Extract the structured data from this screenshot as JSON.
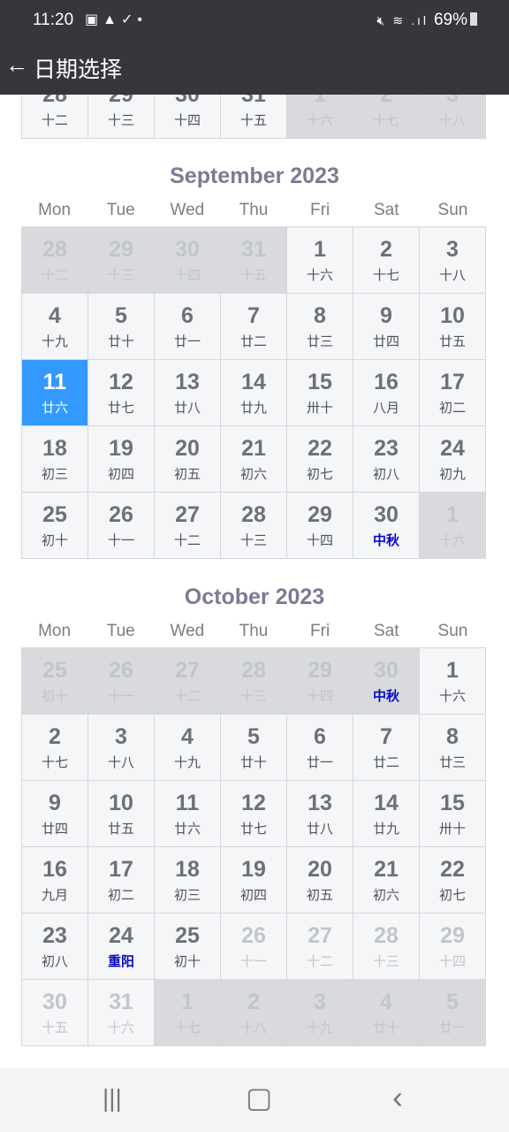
{
  "status": {
    "time": "11:20",
    "left_icons": [
      "image-icon",
      "warning-icon",
      "check-icon",
      "dot-icon"
    ],
    "right_icons": [
      "mute-icon",
      "wifi-icon",
      "signal-icon"
    ],
    "battery": "69%"
  },
  "appbar": {
    "back_icon": "arrow-left-icon",
    "title": "日期选择"
  },
  "colors": {
    "selected": "#3399ff",
    "holiday": "#0a0ac8",
    "header": "#36373b"
  },
  "partial_row": [
    [
      "28",
      "十二",
      "normal"
    ],
    [
      "29",
      "十三",
      "normal"
    ],
    [
      "30",
      "十四",
      "normal"
    ],
    [
      "31",
      "十五",
      "normal"
    ],
    [
      "1",
      "十六",
      "other"
    ],
    [
      "2",
      "十七",
      "other"
    ],
    [
      "3",
      "十八",
      "other"
    ]
  ],
  "months": [
    {
      "title": "September 2023",
      "weekdays": [
        "Mon",
        "Tue",
        "Wed",
        "Thu",
        "Fri",
        "Sat",
        "Sun"
      ],
      "cells": [
        [
          "28",
          "十二",
          "other"
        ],
        [
          "29",
          "十三",
          "other"
        ],
        [
          "30",
          "十四",
          "other"
        ],
        [
          "31",
          "十五",
          "other"
        ],
        [
          "1",
          "十六",
          "normal"
        ],
        [
          "2",
          "十七",
          "normal"
        ],
        [
          "3",
          "十八",
          "normal"
        ],
        [
          "4",
          "十九",
          "normal"
        ],
        [
          "5",
          "廿十",
          "normal"
        ],
        [
          "6",
          "廿一",
          "normal"
        ],
        [
          "7",
          "廿二",
          "normal"
        ],
        [
          "8",
          "廿三",
          "normal"
        ],
        [
          "9",
          "廿四",
          "normal"
        ],
        [
          "10",
          "廿五",
          "normal"
        ],
        [
          "11",
          "廿六",
          "selected"
        ],
        [
          "12",
          "廿七",
          "normal"
        ],
        [
          "13",
          "廿八",
          "normal"
        ],
        [
          "14",
          "廿九",
          "normal"
        ],
        [
          "15",
          "卅十",
          "normal"
        ],
        [
          "16",
          "八月",
          "normal"
        ],
        [
          "17",
          "初二",
          "normal"
        ],
        [
          "18",
          "初三",
          "normal"
        ],
        [
          "19",
          "初四",
          "normal"
        ],
        [
          "20",
          "初五",
          "normal"
        ],
        [
          "21",
          "初六",
          "normal"
        ],
        [
          "22",
          "初七",
          "normal"
        ],
        [
          "23",
          "初八",
          "normal"
        ],
        [
          "24",
          "初九",
          "normal"
        ],
        [
          "25",
          "初十",
          "normal"
        ],
        [
          "26",
          "十一",
          "normal"
        ],
        [
          "27",
          "十二",
          "normal"
        ],
        [
          "28",
          "十三",
          "normal"
        ],
        [
          "29",
          "十四",
          "normal"
        ],
        [
          "30",
          "中秋",
          "holiday"
        ],
        [
          "1",
          "十六",
          "other"
        ]
      ]
    },
    {
      "title": "October 2023",
      "weekdays": [
        "Mon",
        "Tue",
        "Wed",
        "Thu",
        "Fri",
        "Sat",
        "Sun"
      ],
      "cells": [
        [
          "25",
          "初十",
          "other"
        ],
        [
          "26",
          "十一",
          "other"
        ],
        [
          "27",
          "十二",
          "other"
        ],
        [
          "28",
          "十三",
          "other"
        ],
        [
          "29",
          "十四",
          "other"
        ],
        [
          "30",
          "中秋",
          "other holiday"
        ],
        [
          "1",
          "十六",
          "normal"
        ],
        [
          "2",
          "十七",
          "normal"
        ],
        [
          "3",
          "十八",
          "normal"
        ],
        [
          "4",
          "十九",
          "normal"
        ],
        [
          "5",
          "廿十",
          "normal"
        ],
        [
          "6",
          "廿一",
          "normal"
        ],
        [
          "7",
          "廿二",
          "normal"
        ],
        [
          "8",
          "廿三",
          "normal"
        ],
        [
          "9",
          "廿四",
          "normal"
        ],
        [
          "10",
          "廿五",
          "normal"
        ],
        [
          "11",
          "廿六",
          "normal"
        ],
        [
          "12",
          "廿七",
          "normal"
        ],
        [
          "13",
          "廿八",
          "normal"
        ],
        [
          "14",
          "廿九",
          "normal"
        ],
        [
          "15",
          "卅十",
          "normal"
        ],
        [
          "16",
          "九月",
          "normal"
        ],
        [
          "17",
          "初二",
          "normal"
        ],
        [
          "18",
          "初三",
          "normal"
        ],
        [
          "19",
          "初四",
          "normal"
        ],
        [
          "20",
          "初五",
          "normal"
        ],
        [
          "21",
          "初六",
          "normal"
        ],
        [
          "22",
          "初七",
          "normal"
        ],
        [
          "23",
          "初八",
          "normal"
        ],
        [
          "24",
          "重阳",
          "holiday"
        ],
        [
          "25",
          "初十",
          "normal"
        ],
        [
          "26",
          "十一",
          "disabled"
        ],
        [
          "27",
          "十二",
          "disabled"
        ],
        [
          "28",
          "十三",
          "disabled"
        ],
        [
          "29",
          "十四",
          "disabled"
        ],
        [
          "30",
          "十五",
          "disabled"
        ],
        [
          "31",
          "十六",
          "disabled"
        ],
        [
          "1",
          "十七",
          "other"
        ],
        [
          "2",
          "十八",
          "other"
        ],
        [
          "3",
          "十九",
          "other"
        ],
        [
          "4",
          "廿十",
          "other"
        ],
        [
          "5",
          "廿一",
          "other"
        ]
      ]
    }
  ],
  "navbar": {
    "recents_icon": "|||",
    "home_icon": "▢",
    "back_icon": "‹"
  }
}
